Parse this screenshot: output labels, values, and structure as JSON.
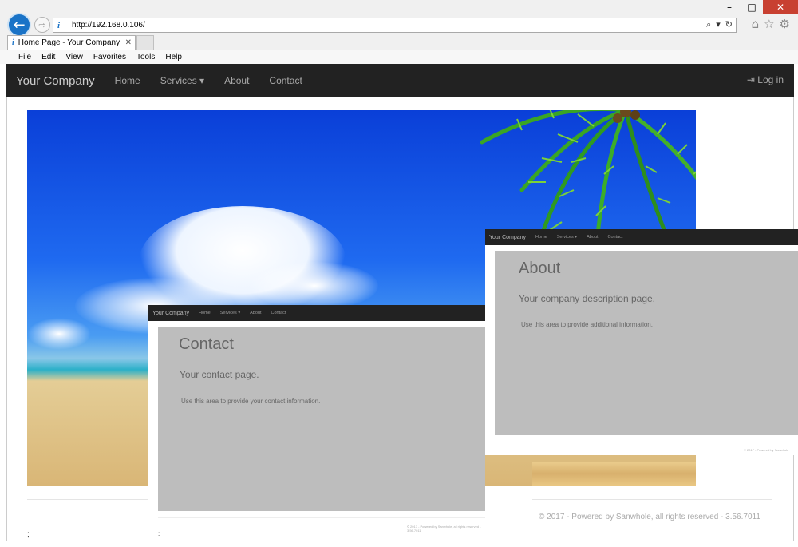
{
  "window": {
    "minimize": "–",
    "maximize": "□",
    "close": "✕"
  },
  "browser": {
    "back_icon": "←",
    "forward_icon": "⇨",
    "address_icon": "i",
    "url": "http://192.168.0.106/",
    "search_icon": "⌕",
    "dropdown_icon": "▾",
    "refresh_icon": "↻",
    "home_icon": "⌂",
    "favorites_icon": "☆",
    "settings_icon": "⚙",
    "tab": {
      "icon": "i",
      "title": "Home Page - Your Company",
      "close": "✕"
    },
    "menu": [
      "File",
      "Edit",
      "View",
      "Favorites",
      "Tools",
      "Help"
    ]
  },
  "site": {
    "brand": "Your Company",
    "nav": [
      "Home",
      "Services ▾",
      "About",
      "Contact"
    ],
    "login": "⇥ Log in"
  },
  "contact_overlay": {
    "brand": "Your Company",
    "nav": [
      "Home",
      "Services ▾",
      "About",
      "Contact"
    ],
    "title": "Contact",
    "lead": "Your contact page.",
    "text": "Use this area to provide your contact information.",
    "footer": "© 2017 - Powered by Sanwhole, all rights reserved - 3.56.7011",
    "marker": ":"
  },
  "about_overlay": {
    "brand": "Your Company",
    "nav": [
      "Home",
      "Services ▾",
      "About",
      "Contact"
    ],
    "title": "About",
    "lead": "Your company description page.",
    "text": "Use this area to provide additional information.",
    "footer": "© 2017 - Powered by Sanwhole",
    "marker": ":"
  },
  "footer": {
    "text": "© 2017 - Powered by Sanwhole, all rights reserved - 3.56.7011",
    "marker": ";"
  },
  "colors": {
    "navbar_bg": "#222222",
    "browser_accent": "#1a73c7",
    "close_button": "#c84031",
    "jumbotron_gray": "#bdbdbd"
  }
}
